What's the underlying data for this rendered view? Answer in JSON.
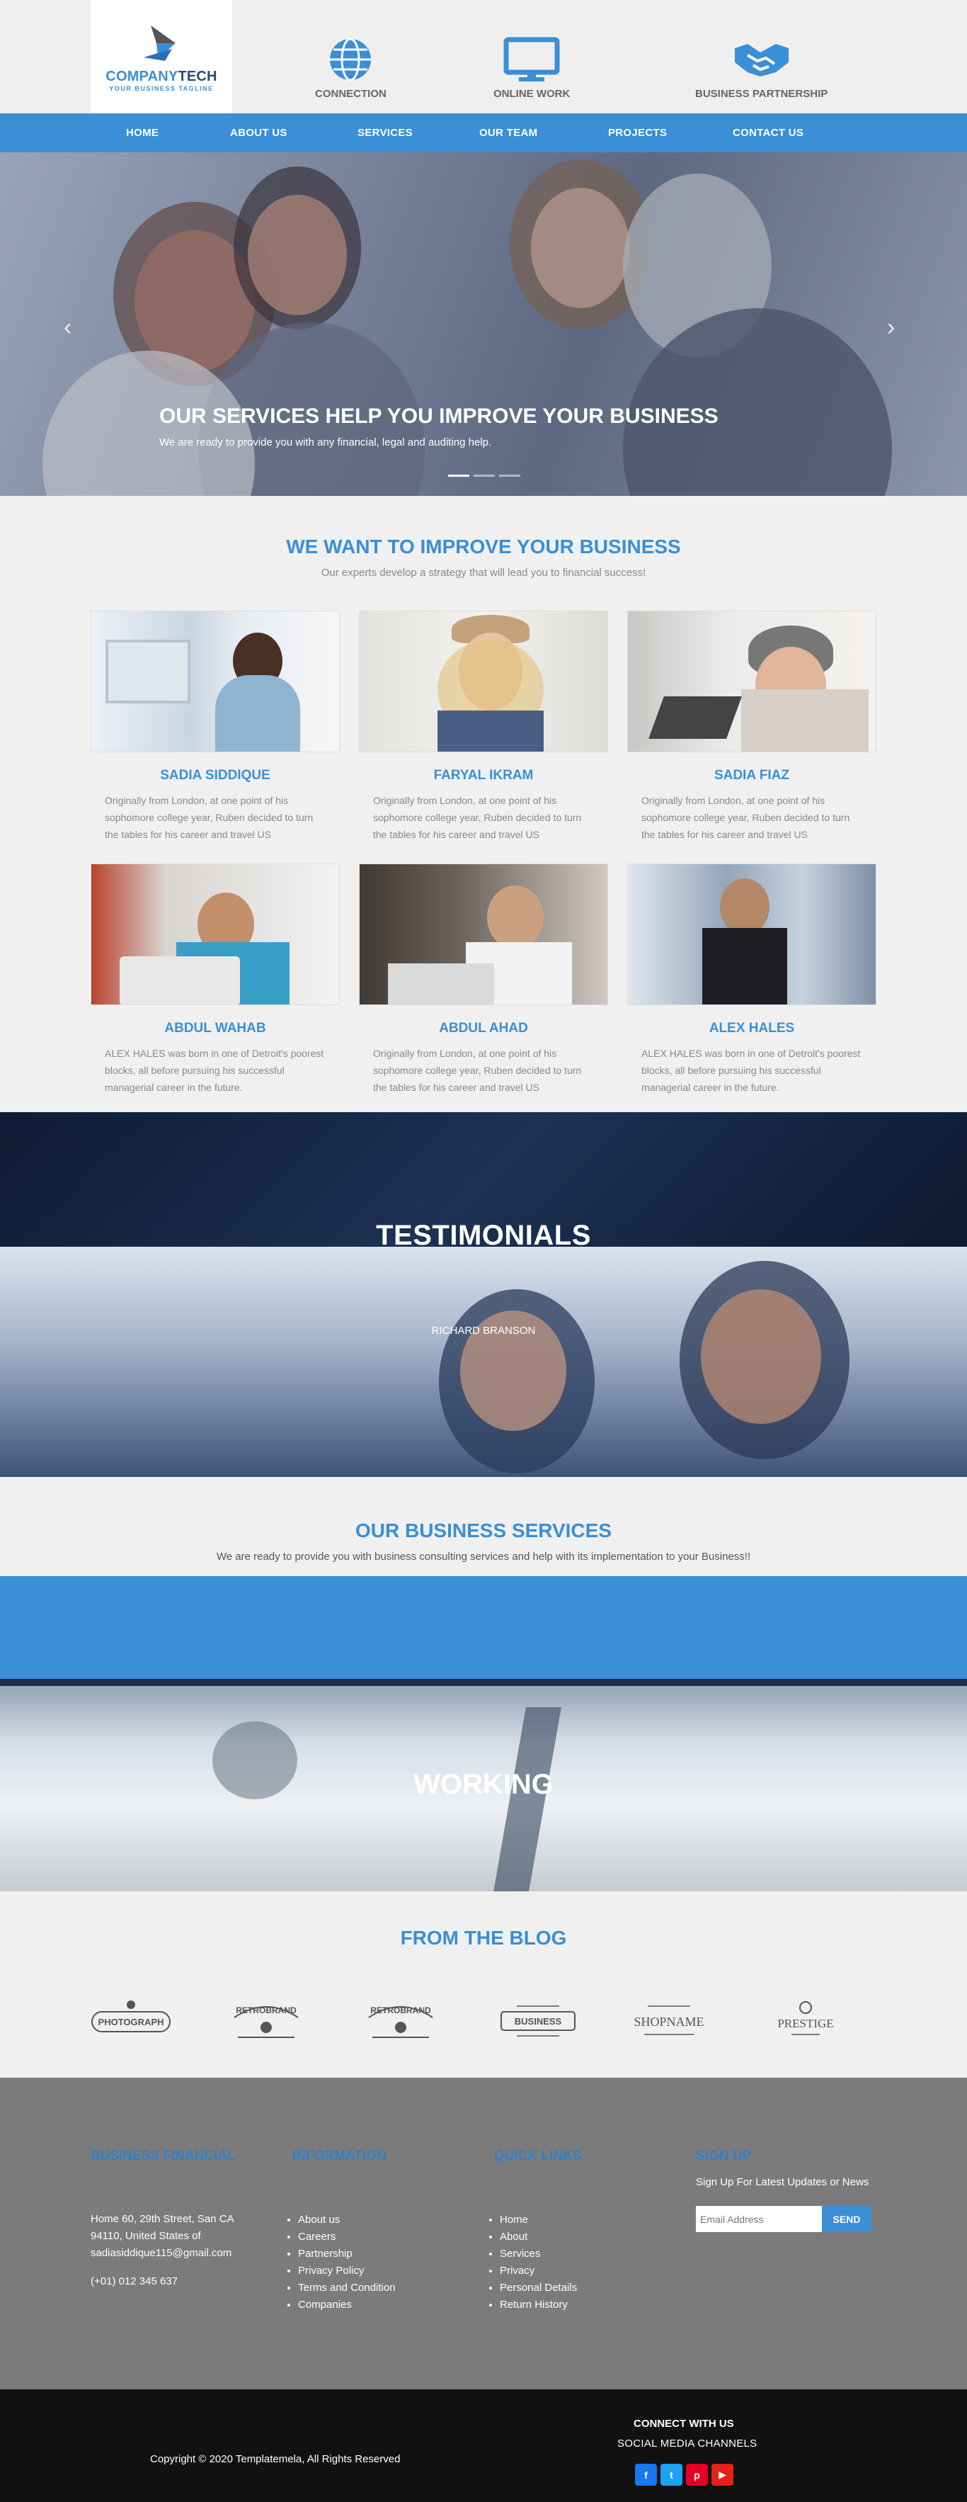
{
  "brand": {
    "name_a": "COMPANY",
    "name_b": "TECH",
    "tagline": "YOUR BUSINESS TAGLINE"
  },
  "features": [
    {
      "label": "CONNECTION",
      "icon": "globe-icon"
    },
    {
      "label": "ONLINE WORK",
      "icon": "monitor-icon"
    },
    {
      "label": "BUSINESS PARTNERSHIP",
      "icon": "handshake-icon"
    }
  ],
  "nav": [
    "HOME",
    "ABOUT US",
    "SERVICES",
    "OUR TEAM",
    "PROJECTS",
    "CONTACT US"
  ],
  "hero": {
    "title": "OUR SERVICES HELP YOU IMPROVE YOUR BUSINESS",
    "text": "We are ready to provide you with any financial, legal and auditing help.",
    "prev": "‹",
    "next": "›"
  },
  "team": {
    "title": "WE WANT TO IMPROVE YOUR BUSINESS",
    "subtitle": "Our experts develop a strategy that will lead you to financial success!",
    "members": [
      {
        "name": "SADIA SIDDIQUE",
        "bio": "Originally from London, at one point of his sophomore college year, Ruben decided to turn the tables for his career and travel US"
      },
      {
        "name": "FARYAL IKRAM",
        "bio": "Originally from London, at one point of his sophomore college year, Ruben decided to turn the tables for his career and travel US"
      },
      {
        "name": "SADIA FIAZ",
        "bio": "Originally from London, at one point of his sophomore college year, Ruben decided to turn the tables for his career and travel US"
      },
      {
        "name": "ABDUL WAHAB",
        "bio": "ALEX HALES was born in one of Detroit's poorest blocks, all before pursuing his successful managerial career in the future."
      },
      {
        "name": "ABDUL AHAD",
        "bio": "Originally from London, at one point of his sophomore college year, Ruben decided to turn the tables for his career and travel US"
      },
      {
        "name": "ALEX HALES",
        "bio": "ALEX HALES was born in one of Detroit's poorest blocks, all before pursuing his successful managerial career in the future."
      }
    ]
  },
  "testimonials": {
    "title": "TESTIMONIALS",
    "author": "RICHARD BRANSON"
  },
  "services": {
    "title": "OUR BUSINESS SERVICES",
    "subtitle": "We are ready to provide you with business consulting services and help with its implementation to your Business!!"
  },
  "working": {
    "title": "WORKING"
  },
  "blog": {
    "title": "FROM THE BLOG",
    "logos": [
      "PHOTOGRAPH",
      "RETROBRAND",
      "RETROBRAND",
      "BUSINESS",
      "SHOPNAME",
      "PRESTIGE"
    ]
  },
  "footer": {
    "col1": {
      "title": "BUSINESS FINANCIAL",
      "address": "Home 60, 29th Street, San CA 94110, United States of",
      "email": "sadiasiddique115@gmail.com",
      "phone": "(+01) 012 345 637"
    },
    "col2": {
      "title": "INFORMATION",
      "links": [
        "About us",
        "Careers",
        "Partnership",
        "Privacy Policy",
        "Terms and Condition",
        "Companies"
      ]
    },
    "col3": {
      "title": "QUICK LINKS",
      "links": [
        "Home",
        "About",
        "Services",
        "Privacy",
        "Personal Details",
        "Return History"
      ]
    },
    "col4": {
      "title": "SIGN UP",
      "text": "Sign Up For Latest Updates or News",
      "placeholder": "Email Address",
      "button": "SEND"
    }
  },
  "bottom": {
    "copyright": "Copyright © 2020 Templatemela, All Rights Reserved",
    "connect": "CONNECT WITH US",
    "social_title": "SOCIAL MEDIA CHANNELS",
    "social": [
      {
        "icon": "facebook-icon",
        "color": "#1877f2"
      },
      {
        "icon": "twitter-icon",
        "color": "#1da1f2"
      },
      {
        "icon": "pinterest-icon",
        "color": "#e60023"
      },
      {
        "icon": "youtube-icon",
        "color": "#e62117"
      }
    ]
  }
}
